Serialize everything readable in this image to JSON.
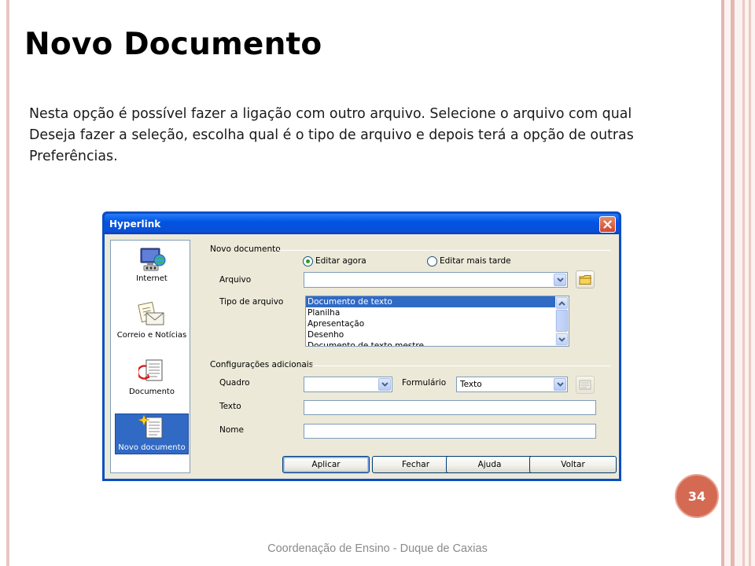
{
  "slide": {
    "title": "Novo Documento",
    "paragraph_lines": [
      "Nesta opção é possível fazer a ligação com outro arquivo. Selecione o arquivo com qual",
      "Deseja fazer a seleção, escolha qual é o tipo de arquivo e depois terá a opção de outras",
      "Preferências."
    ],
    "page_number": "34",
    "footer": "Coordenação de Ensino - Duque de Caxias"
  },
  "dialog": {
    "title": "Hyperlink",
    "categories": [
      {
        "label": "Internet",
        "icon": "internet-icon"
      },
      {
        "label": "Correio e Notícias",
        "icon": "mail-news-icon"
      },
      {
        "label": "Documento",
        "icon": "document-icon"
      },
      {
        "label": "Novo documento",
        "icon": "new-document-icon",
        "selected": true
      }
    ],
    "new_document": {
      "group_label": "Novo documento",
      "radio_edit_now": "Editar agora",
      "radio_edit_later": "Editar mais tarde",
      "selected_radio": "Editar agora",
      "file_label": "Arquivo",
      "file_value": "",
      "file_type_label": "Tipo de arquivo",
      "file_types": [
        "Documento de texto",
        "Planilha",
        "Apresentação",
        "Desenho",
        "Documento de texto mestre"
      ],
      "selected_file_type": "Documento de texto"
    },
    "additional": {
      "group_label": "Configurações adicionais",
      "frame_label": "Quadro",
      "frame_value": "",
      "form_label": "Formulário",
      "form_value": "Texto",
      "text_label": "Texto",
      "text_value": "",
      "name_label": "Nome",
      "name_value": ""
    },
    "buttons": {
      "apply": "Aplicar",
      "close": "Fechar",
      "help": "Ajuda",
      "back": "Voltar"
    }
  },
  "colors": {
    "title_bar": "#0054e3",
    "selection": "#316ac5",
    "badge": "#d46a52",
    "dialog_face": "#ece9d8"
  }
}
